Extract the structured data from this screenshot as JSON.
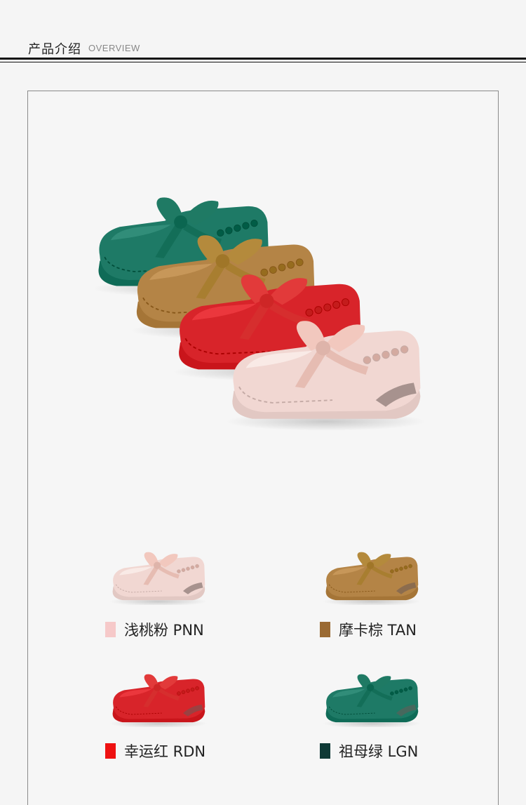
{
  "header": {
    "title_cn": "产品介绍",
    "title_en": "OVERVIEW"
  },
  "hero": {
    "shoes": [
      {
        "icon": "loafer-shoe-image",
        "color": "#1e7a66",
        "lace": "#1f7a64"
      },
      {
        "icon": "loafer-shoe-image",
        "color": "#b48446",
        "lace": "#b48a3c"
      },
      {
        "icon": "loafer-shoe-image",
        "color": "#d8242a",
        "lace": "#e23a3a"
      },
      {
        "icon": "loafer-shoe-image",
        "color": "#f1d7d2",
        "lace": "#f2c8be"
      }
    ]
  },
  "colors": [
    {
      "label": "浅桃粉 PNN",
      "swatch": "#f6c9c9",
      "shoe": "#f1d7d2",
      "lace": "#f2c8be"
    },
    {
      "label": "摩卡棕 TAN",
      "swatch": "#9a6a33",
      "shoe": "#b48446",
      "lace": "#b48a3c"
    },
    {
      "label": "幸运红 RDN",
      "swatch": "#ee1111",
      "shoe": "#d8242a",
      "lace": "#e23a3a"
    },
    {
      "label": "祖母绿 LGN",
      "swatch": "#0f3a36",
      "shoe": "#1e7a66",
      "lace": "#1f7a64"
    }
  ]
}
